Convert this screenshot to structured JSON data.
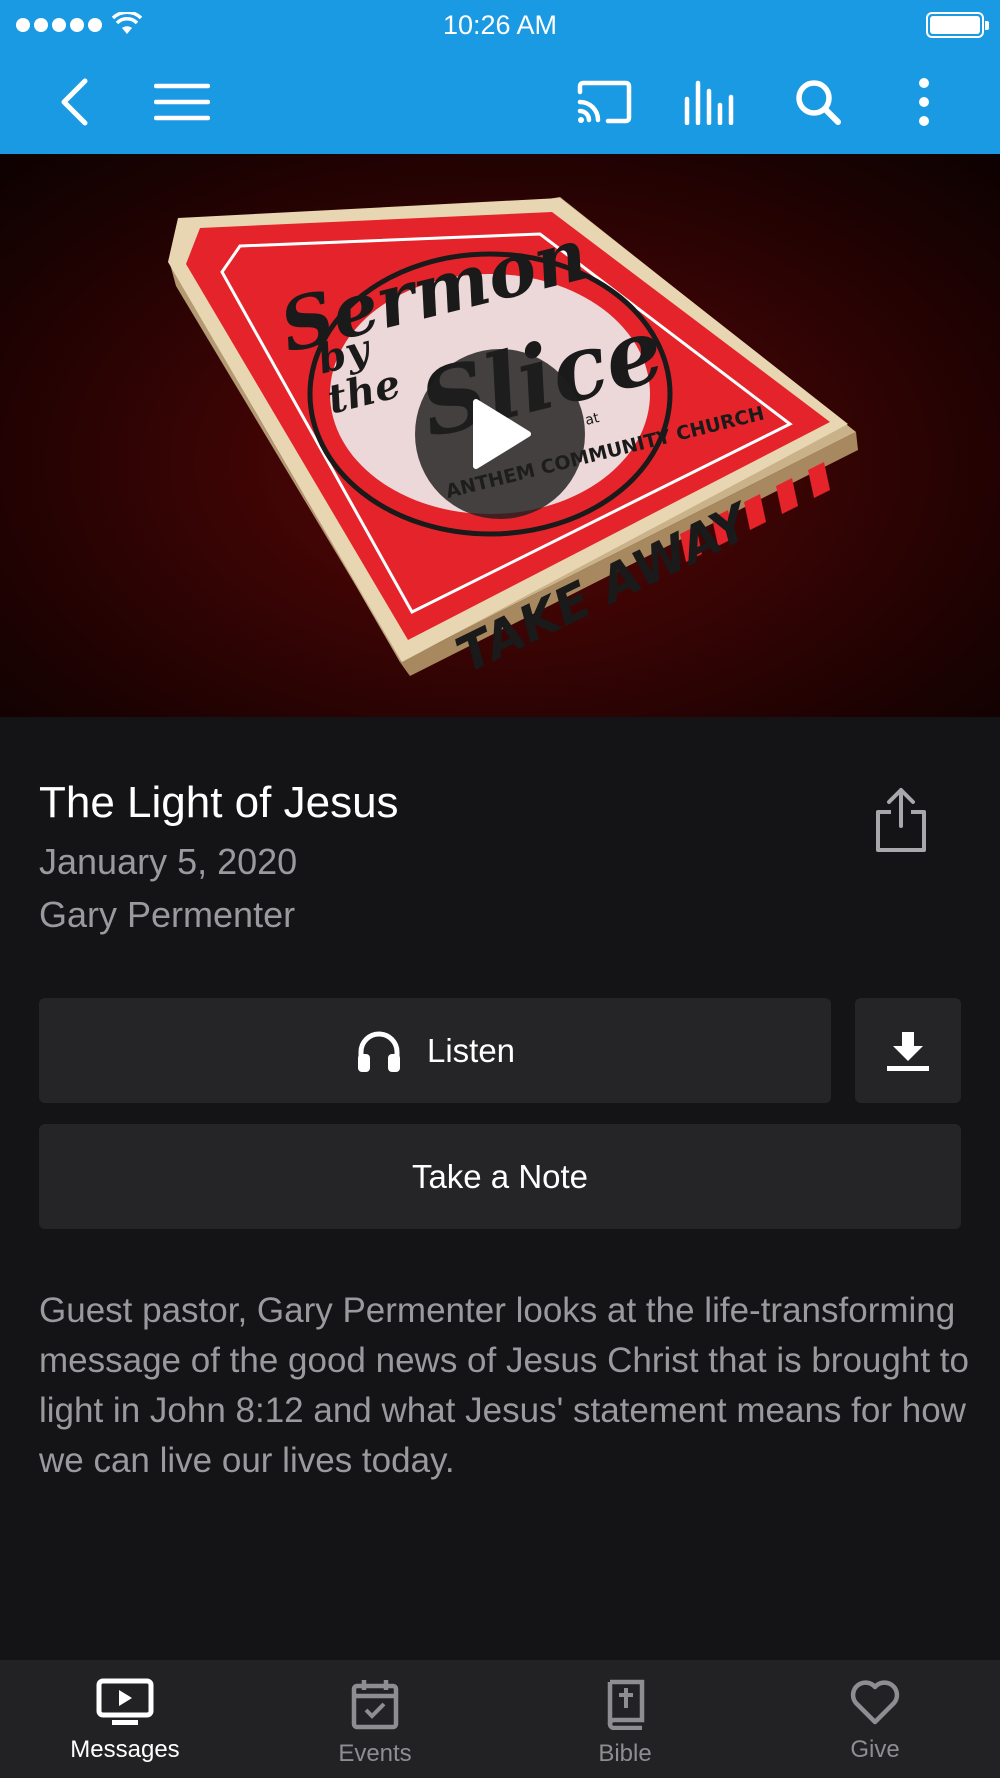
{
  "status_bar": {
    "time": "10:26 AM"
  },
  "sermon": {
    "title": "The Light of Jesus",
    "date": "January 5, 2020",
    "speaker": "Gary Permenter",
    "description": "Guest pastor, Gary Permenter looks at the life-transforming message of the good news of Jesus Christ that is brought to light in John 8:12 and what Jesus' statement means for how we can live our lives today."
  },
  "artwork": {
    "line1": "Sermon",
    "line2": "by",
    "line3": "the",
    "line4": "Slice",
    "at": "at",
    "church": "ANTHEM COMMUNITY CHURCH",
    "takeaway": "TAKE AWAY"
  },
  "actions": {
    "listen_label": "Listen",
    "note_label": "Take a Note"
  },
  "tabs": [
    {
      "label": "Messages",
      "icon": "tv-play-icon",
      "active": true
    },
    {
      "label": "Events",
      "icon": "calendar-check-icon",
      "active": false
    },
    {
      "label": "Bible",
      "icon": "bible-icon",
      "active": false
    },
    {
      "label": "Give",
      "icon": "heart-icon",
      "active": false
    }
  ],
  "colors": {
    "nav": "#1a9ae3",
    "background": "#141416",
    "button": "#252527",
    "muted_text": "#9a9a9e"
  }
}
